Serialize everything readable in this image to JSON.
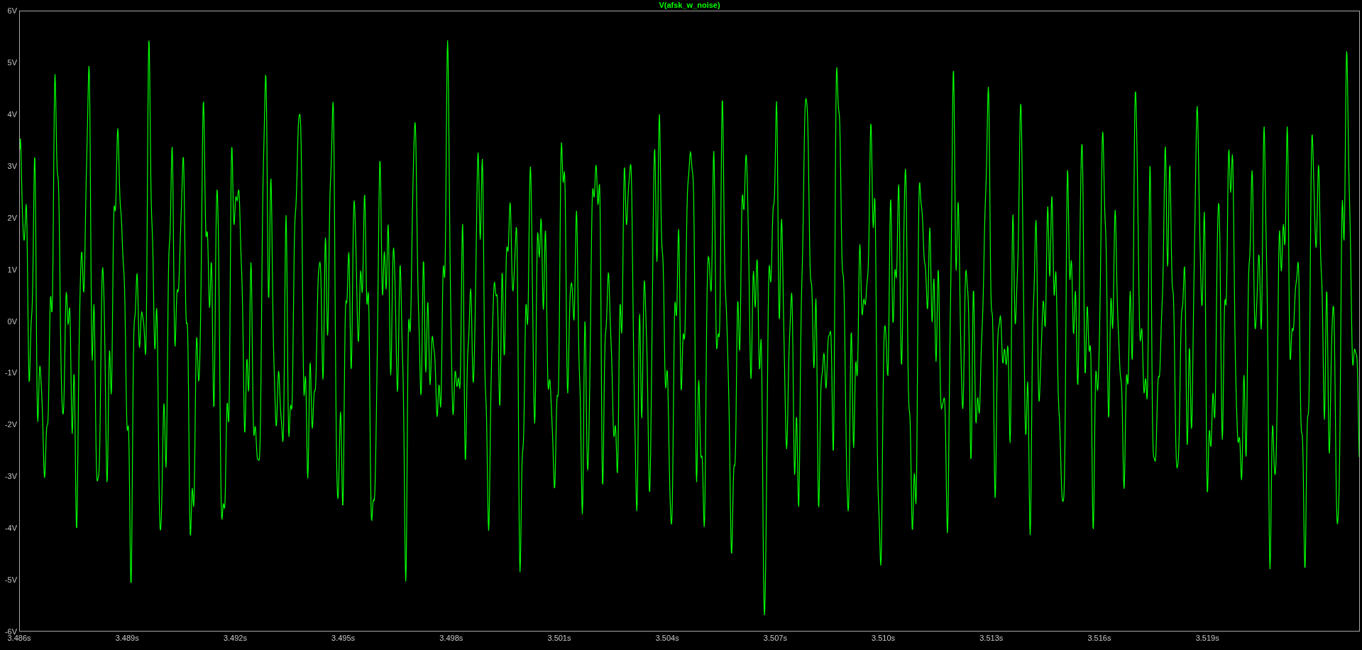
{
  "plot": {
    "trace_title": "V(afsk_w_noise)",
    "y_ticks": [
      "6V",
      "5V",
      "4V",
      "3V",
      "2V",
      "1V",
      "0V",
      "-1V",
      "-2V",
      "-3V",
      "-4V",
      "-5V",
      "-6V"
    ],
    "x_ticks": [
      "3.486s",
      "3.489s",
      "3.492s",
      "3.495s",
      "3.498s",
      "3.501s",
      "3.504s",
      "3.507s",
      "3.510s",
      "3.513s",
      "3.516s",
      "3.519s"
    ]
  }
}
